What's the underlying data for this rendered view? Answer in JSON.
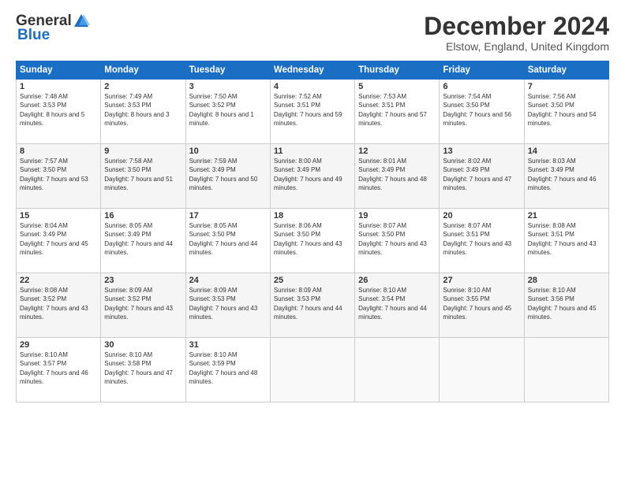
{
  "header": {
    "logo_general": "General",
    "logo_blue": "Blue",
    "month_title": "December 2024",
    "location": "Elstow, England, United Kingdom"
  },
  "weekdays": [
    "Sunday",
    "Monday",
    "Tuesday",
    "Wednesday",
    "Thursday",
    "Friday",
    "Saturday"
  ],
  "weeks": [
    [
      {
        "day": "1",
        "sunrise": "7:48 AM",
        "sunset": "3:53 PM",
        "daylight": "8 hours and 5 minutes."
      },
      {
        "day": "2",
        "sunrise": "7:49 AM",
        "sunset": "3:53 PM",
        "daylight": "8 hours and 3 minutes."
      },
      {
        "day": "3",
        "sunrise": "7:50 AM",
        "sunset": "3:52 PM",
        "daylight": "8 hours and 1 minute."
      },
      {
        "day": "4",
        "sunrise": "7:52 AM",
        "sunset": "3:51 PM",
        "daylight": "7 hours and 59 minutes."
      },
      {
        "day": "5",
        "sunrise": "7:53 AM",
        "sunset": "3:51 PM",
        "daylight": "7 hours and 57 minutes."
      },
      {
        "day": "6",
        "sunrise": "7:54 AM",
        "sunset": "3:50 PM",
        "daylight": "7 hours and 56 minutes."
      },
      {
        "day": "7",
        "sunrise": "7:56 AM",
        "sunset": "3:50 PM",
        "daylight": "7 hours and 54 minutes."
      }
    ],
    [
      {
        "day": "8",
        "sunrise": "7:57 AM",
        "sunset": "3:50 PM",
        "daylight": "7 hours and 53 minutes."
      },
      {
        "day": "9",
        "sunrise": "7:58 AM",
        "sunset": "3:50 PM",
        "daylight": "7 hours and 51 minutes."
      },
      {
        "day": "10",
        "sunrise": "7:59 AM",
        "sunset": "3:49 PM",
        "daylight": "7 hours and 50 minutes."
      },
      {
        "day": "11",
        "sunrise": "8:00 AM",
        "sunset": "3:49 PM",
        "daylight": "7 hours and 49 minutes."
      },
      {
        "day": "12",
        "sunrise": "8:01 AM",
        "sunset": "3:49 PM",
        "daylight": "7 hours and 48 minutes."
      },
      {
        "day": "13",
        "sunrise": "8:02 AM",
        "sunset": "3:49 PM",
        "daylight": "7 hours and 47 minutes."
      },
      {
        "day": "14",
        "sunrise": "8:03 AM",
        "sunset": "3:49 PM",
        "daylight": "7 hours and 46 minutes."
      }
    ],
    [
      {
        "day": "15",
        "sunrise": "8:04 AM",
        "sunset": "3:49 PM",
        "daylight": "7 hours and 45 minutes."
      },
      {
        "day": "16",
        "sunrise": "8:05 AM",
        "sunset": "3:49 PM",
        "daylight": "7 hours and 44 minutes."
      },
      {
        "day": "17",
        "sunrise": "8:05 AM",
        "sunset": "3:50 PM",
        "daylight": "7 hours and 44 minutes."
      },
      {
        "day": "18",
        "sunrise": "8:06 AM",
        "sunset": "3:50 PM",
        "daylight": "7 hours and 43 minutes."
      },
      {
        "day": "19",
        "sunrise": "8:07 AM",
        "sunset": "3:50 PM",
        "daylight": "7 hours and 43 minutes."
      },
      {
        "day": "20",
        "sunrise": "8:07 AM",
        "sunset": "3:51 PM",
        "daylight": "7 hours and 43 minutes."
      },
      {
        "day": "21",
        "sunrise": "8:08 AM",
        "sunset": "3:51 PM",
        "daylight": "7 hours and 43 minutes."
      }
    ],
    [
      {
        "day": "22",
        "sunrise": "8:08 AM",
        "sunset": "3:52 PM",
        "daylight": "7 hours and 43 minutes."
      },
      {
        "day": "23",
        "sunrise": "8:09 AM",
        "sunset": "3:52 PM",
        "daylight": "7 hours and 43 minutes."
      },
      {
        "day": "24",
        "sunrise": "8:09 AM",
        "sunset": "3:53 PM",
        "daylight": "7 hours and 43 minutes."
      },
      {
        "day": "25",
        "sunrise": "8:09 AM",
        "sunset": "3:53 PM",
        "daylight": "7 hours and 44 minutes."
      },
      {
        "day": "26",
        "sunrise": "8:10 AM",
        "sunset": "3:54 PM",
        "daylight": "7 hours and 44 minutes."
      },
      {
        "day": "27",
        "sunrise": "8:10 AM",
        "sunset": "3:55 PM",
        "daylight": "7 hours and 45 minutes."
      },
      {
        "day": "28",
        "sunrise": "8:10 AM",
        "sunset": "3:56 PM",
        "daylight": "7 hours and 45 minutes."
      }
    ],
    [
      {
        "day": "29",
        "sunrise": "8:10 AM",
        "sunset": "3:57 PM",
        "daylight": "7 hours and 46 minutes."
      },
      {
        "day": "30",
        "sunrise": "8:10 AM",
        "sunset": "3:58 PM",
        "daylight": "7 hours and 47 minutes."
      },
      {
        "day": "31",
        "sunrise": "8:10 AM",
        "sunset": "3:59 PM",
        "daylight": "7 hours and 48 minutes."
      },
      null,
      null,
      null,
      null
    ]
  ]
}
